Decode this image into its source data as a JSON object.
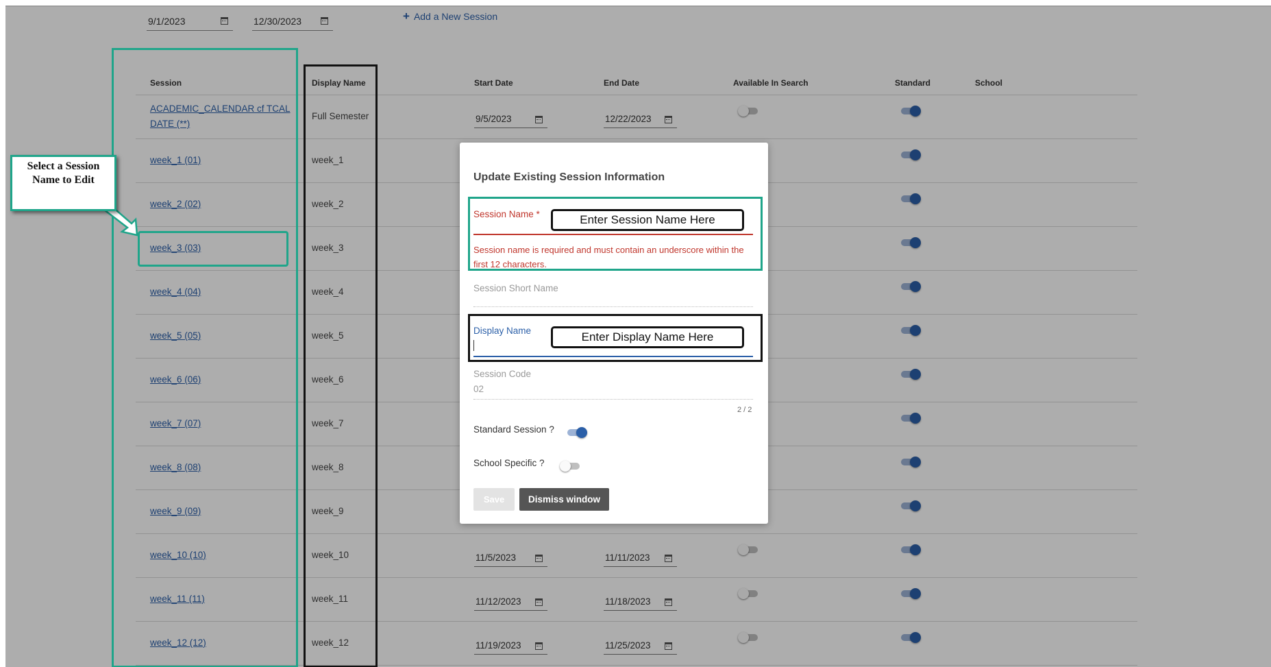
{
  "filters": {
    "start_date": "9/1/2023",
    "end_date": "12/30/2023",
    "add_session_label": "Add a New Session"
  },
  "table": {
    "headers": [
      "Session",
      "Display Name",
      "Start Date",
      "End Date",
      "Available In Search",
      "Standard",
      "School"
    ],
    "rows": [
      {
        "session": "ACADEMIC_CALENDAR cf TCAL DATE (**)",
        "display": "Full Semester",
        "start": "9/5/2023",
        "end": "12/22/2023"
      },
      {
        "session": "week_1 (01)",
        "display": "week_1",
        "start": "",
        "end": ""
      },
      {
        "session": "week_2 (02)",
        "display": "week_2",
        "start": "",
        "end": ""
      },
      {
        "session": "week_3 (03)",
        "display": "week_3",
        "start": "",
        "end": ""
      },
      {
        "session": "week_4 (04)",
        "display": "week_4",
        "start": "",
        "end": ""
      },
      {
        "session": "week_5 (05)",
        "display": "week_5",
        "start": "",
        "end": ""
      },
      {
        "session": "week_6 (06)",
        "display": "week_6",
        "start": "",
        "end": ""
      },
      {
        "session": "week_7 (07)",
        "display": "week_7",
        "start": "",
        "end": ""
      },
      {
        "session": "week_8 (08)",
        "display": "week_8",
        "start": "",
        "end": ""
      },
      {
        "session": "week_9 (09)",
        "display": "week_9",
        "start": "",
        "end": ""
      },
      {
        "session": "week_10 (10)",
        "display": "week_10",
        "start": "11/5/2023",
        "end": "11/11/2023"
      },
      {
        "session": "week_11 (11)",
        "display": "week_11",
        "start": "11/12/2023",
        "end": "11/18/2023"
      },
      {
        "session": "week_12 (12)",
        "display": "week_12",
        "start": "11/19/2023",
        "end": "11/25/2023"
      }
    ]
  },
  "annotations": {
    "callout": "Select a Session Name to Edit",
    "session_hint": "Enter Session Name Here",
    "display_hint": "Enter Display Name Here"
  },
  "modal": {
    "title": "Update Existing Session Information",
    "session_name_label": "Session Name *",
    "session_name_error": "Session name is required and must contain an underscore within the first 12 characters.",
    "short_name_label": "Session Short Name",
    "display_name_label": "Display Name",
    "code_label": "Session Code",
    "code_value": "02",
    "code_counter": "2 / 2",
    "standard_label": "Standard Session ?",
    "school_label": "School Specific ?",
    "save_label": "Save",
    "dismiss_label": "Dismiss window"
  },
  "colors": {
    "accent_green": "#1fa58a",
    "link_blue": "#2b5fa8",
    "error_red": "#c0362c"
  }
}
